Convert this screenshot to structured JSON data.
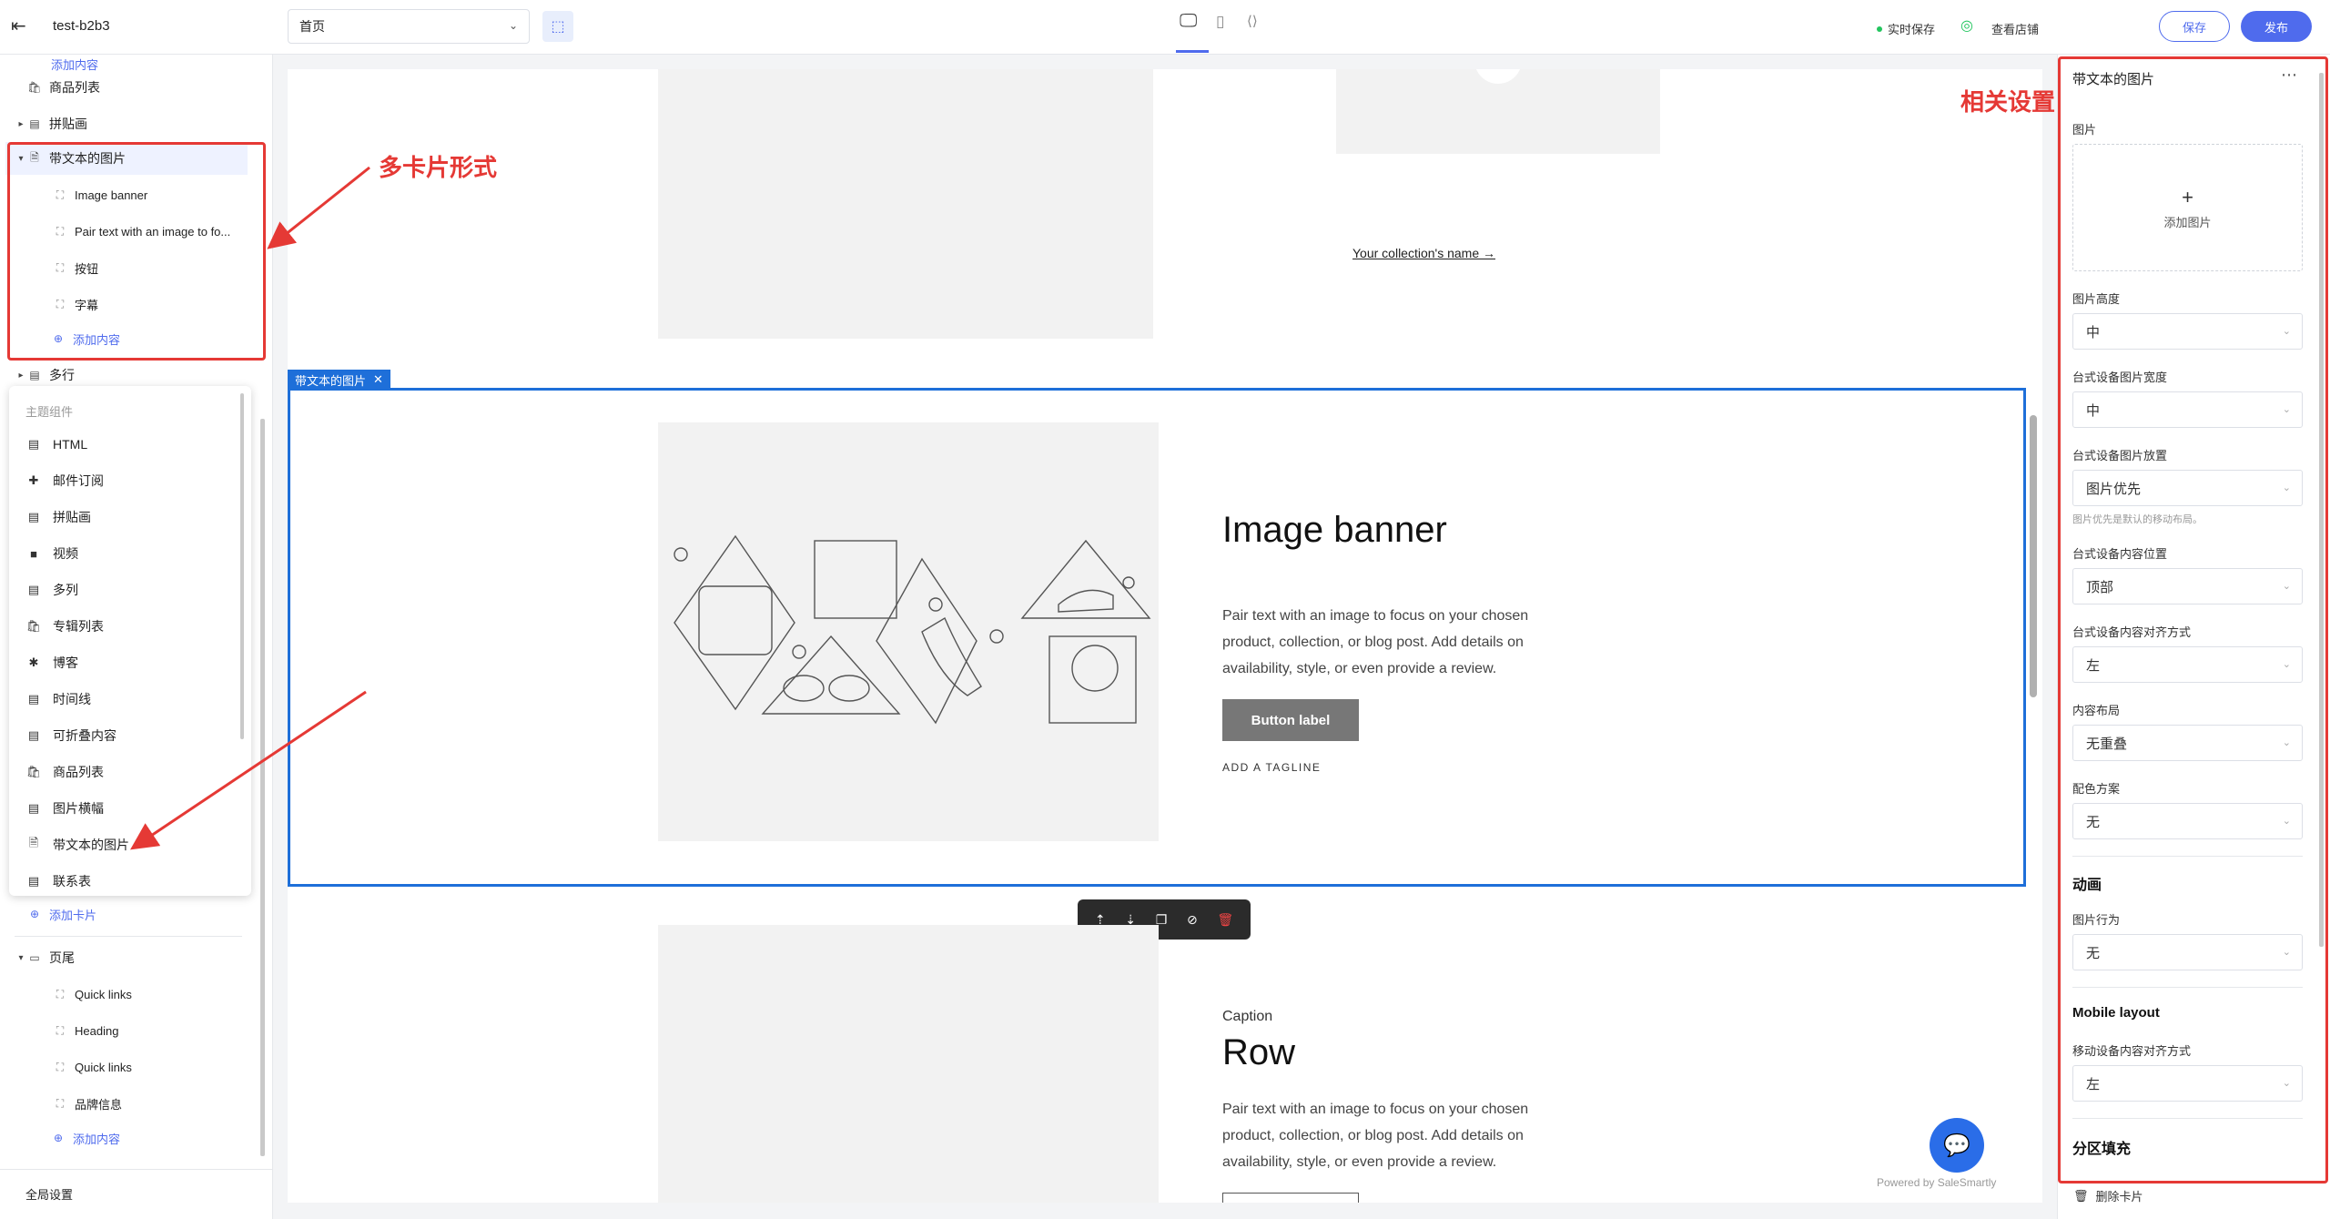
{
  "app": {
    "store_name": "test-b2b3",
    "page_select": "首页",
    "realtime_save": "实时保存",
    "view_store": "查看店铺",
    "save": "保存",
    "publish": "发布"
  },
  "sidebar": {
    "collapsed_label": "添加内容",
    "items": {
      "product_list": "商品列表",
      "collage": "拼贴画",
      "image_with_text": "带文本的图片",
      "image_banner": "Image banner",
      "pair_text": "Pair text with an image to fo...",
      "button": "按钮",
      "caption": "字幕",
      "add_content": "添加内容",
      "multirow": "多行",
      "add_card": "添加卡片",
      "footer": "页尾",
      "quick_links_1": "Quick links",
      "heading": "Heading",
      "quick_links_2": "Quick links",
      "brand_info": "品牌信息",
      "add_content_2": "添加内容",
      "global_settings": "全局设置"
    },
    "dropdown": {
      "header": "主题组件",
      "items": [
        "HTML",
        "邮件订阅",
        "拼贴画",
        "视频",
        "多列",
        "专辑列表",
        "博客",
        "时间线",
        "可折叠内容",
        "商品列表",
        "图片横幅",
        "带文本的图片",
        "联系表"
      ]
    }
  },
  "annotations": {
    "multi_card": "多卡片形式",
    "related_settings": "相关设置"
  },
  "canvas": {
    "collection_link": "Your collection's name →",
    "selected_tag": "带文本的图片",
    "section1": {
      "title": "Image banner",
      "body": [
        "Pair text with an image to focus on your chosen",
        "product, collection, or blog post. Add details on",
        "availability, style, or even provide a review."
      ],
      "button": "Button label",
      "tagline": "ADD A TAGLINE"
    },
    "section2": {
      "caption": "Caption",
      "title": "Row",
      "body": [
        "Pair text with an image to focus on your chosen",
        "product, collection, or blog post. Add details on",
        "availability, style, or even provide a review."
      ]
    },
    "powered_by": "Powered by SaleSmartly"
  },
  "settings": {
    "title": "带文本的图片",
    "image_label": "图片",
    "add_image": "添加图片",
    "image_height_label": "图片高度",
    "image_height": "中",
    "desktop_width_label": "台式设备图片宽度",
    "desktop_width": "中",
    "desktop_placement_label": "台式设备图片放置",
    "desktop_placement": "图片优先",
    "placement_hint": "图片优先是默认的移动布局。",
    "desktop_position_label": "台式设备内容位置",
    "desktop_position": "顶部",
    "desktop_align_label": "台式设备内容对齐方式",
    "desktop_align": "左",
    "content_layout_label": "内容布局",
    "content_layout": "无重叠",
    "color_scheme_label": "配色方案",
    "color_scheme": "无",
    "animation_title": "动画",
    "image_behavior_label": "图片行为",
    "image_behavior": "无",
    "mobile_layout_title": "Mobile layout",
    "mobile_align_label": "移动设备内容对齐方式",
    "mobile_align": "左",
    "section_padding_title": "分区填充",
    "delete_card": "删除卡片"
  },
  "colors": {
    "accent": "#4f6bed",
    "annotation": "#e53935",
    "selected": "#1e6fd9"
  }
}
